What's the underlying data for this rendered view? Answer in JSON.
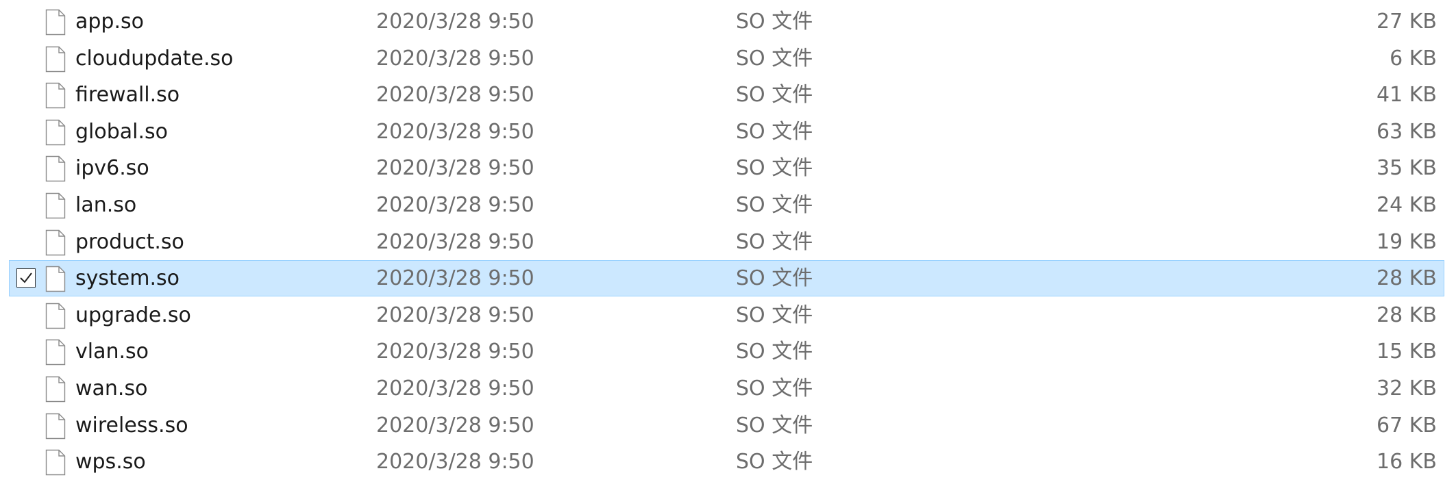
{
  "files": [
    {
      "name": "app.so",
      "date": "2020/3/28 9:50",
      "type": "SO 文件",
      "size": "27 KB",
      "selected": false
    },
    {
      "name": "cloudupdate.so",
      "date": "2020/3/28 9:50",
      "type": "SO 文件",
      "size": "6 KB",
      "selected": false
    },
    {
      "name": "firewall.so",
      "date": "2020/3/28 9:50",
      "type": "SO 文件",
      "size": "41 KB",
      "selected": false
    },
    {
      "name": "global.so",
      "date": "2020/3/28 9:50",
      "type": "SO 文件",
      "size": "63 KB",
      "selected": false
    },
    {
      "name": "ipv6.so",
      "date": "2020/3/28 9:50",
      "type": "SO 文件",
      "size": "35 KB",
      "selected": false
    },
    {
      "name": "lan.so",
      "date": "2020/3/28 9:50",
      "type": "SO 文件",
      "size": "24 KB",
      "selected": false
    },
    {
      "name": "product.so",
      "date": "2020/3/28 9:50",
      "type": "SO 文件",
      "size": "19 KB",
      "selected": false
    },
    {
      "name": "system.so",
      "date": "2020/3/28 9:50",
      "type": "SO 文件",
      "size": "28 KB",
      "selected": true
    },
    {
      "name": "upgrade.so",
      "date": "2020/3/28 9:50",
      "type": "SO 文件",
      "size": "28 KB",
      "selected": false
    },
    {
      "name": "vlan.so",
      "date": "2020/3/28 9:50",
      "type": "SO 文件",
      "size": "15 KB",
      "selected": false
    },
    {
      "name": "wan.so",
      "date": "2020/3/28 9:50",
      "type": "SO 文件",
      "size": "32 KB",
      "selected": false
    },
    {
      "name": "wireless.so",
      "date": "2020/3/28 9:50",
      "type": "SO 文件",
      "size": "67 KB",
      "selected": false
    },
    {
      "name": "wps.so",
      "date": "2020/3/28 9:50",
      "type": "SO 文件",
      "size": "16 KB",
      "selected": false
    }
  ],
  "icons": {
    "file": "generic-file-icon",
    "check": "checkmark-icon"
  },
  "colors": {
    "selection_background": "#cce8ff",
    "selection_border": "#99d1ff",
    "name_text": "#1a1a1a",
    "detail_text": "#6d6d6d"
  }
}
